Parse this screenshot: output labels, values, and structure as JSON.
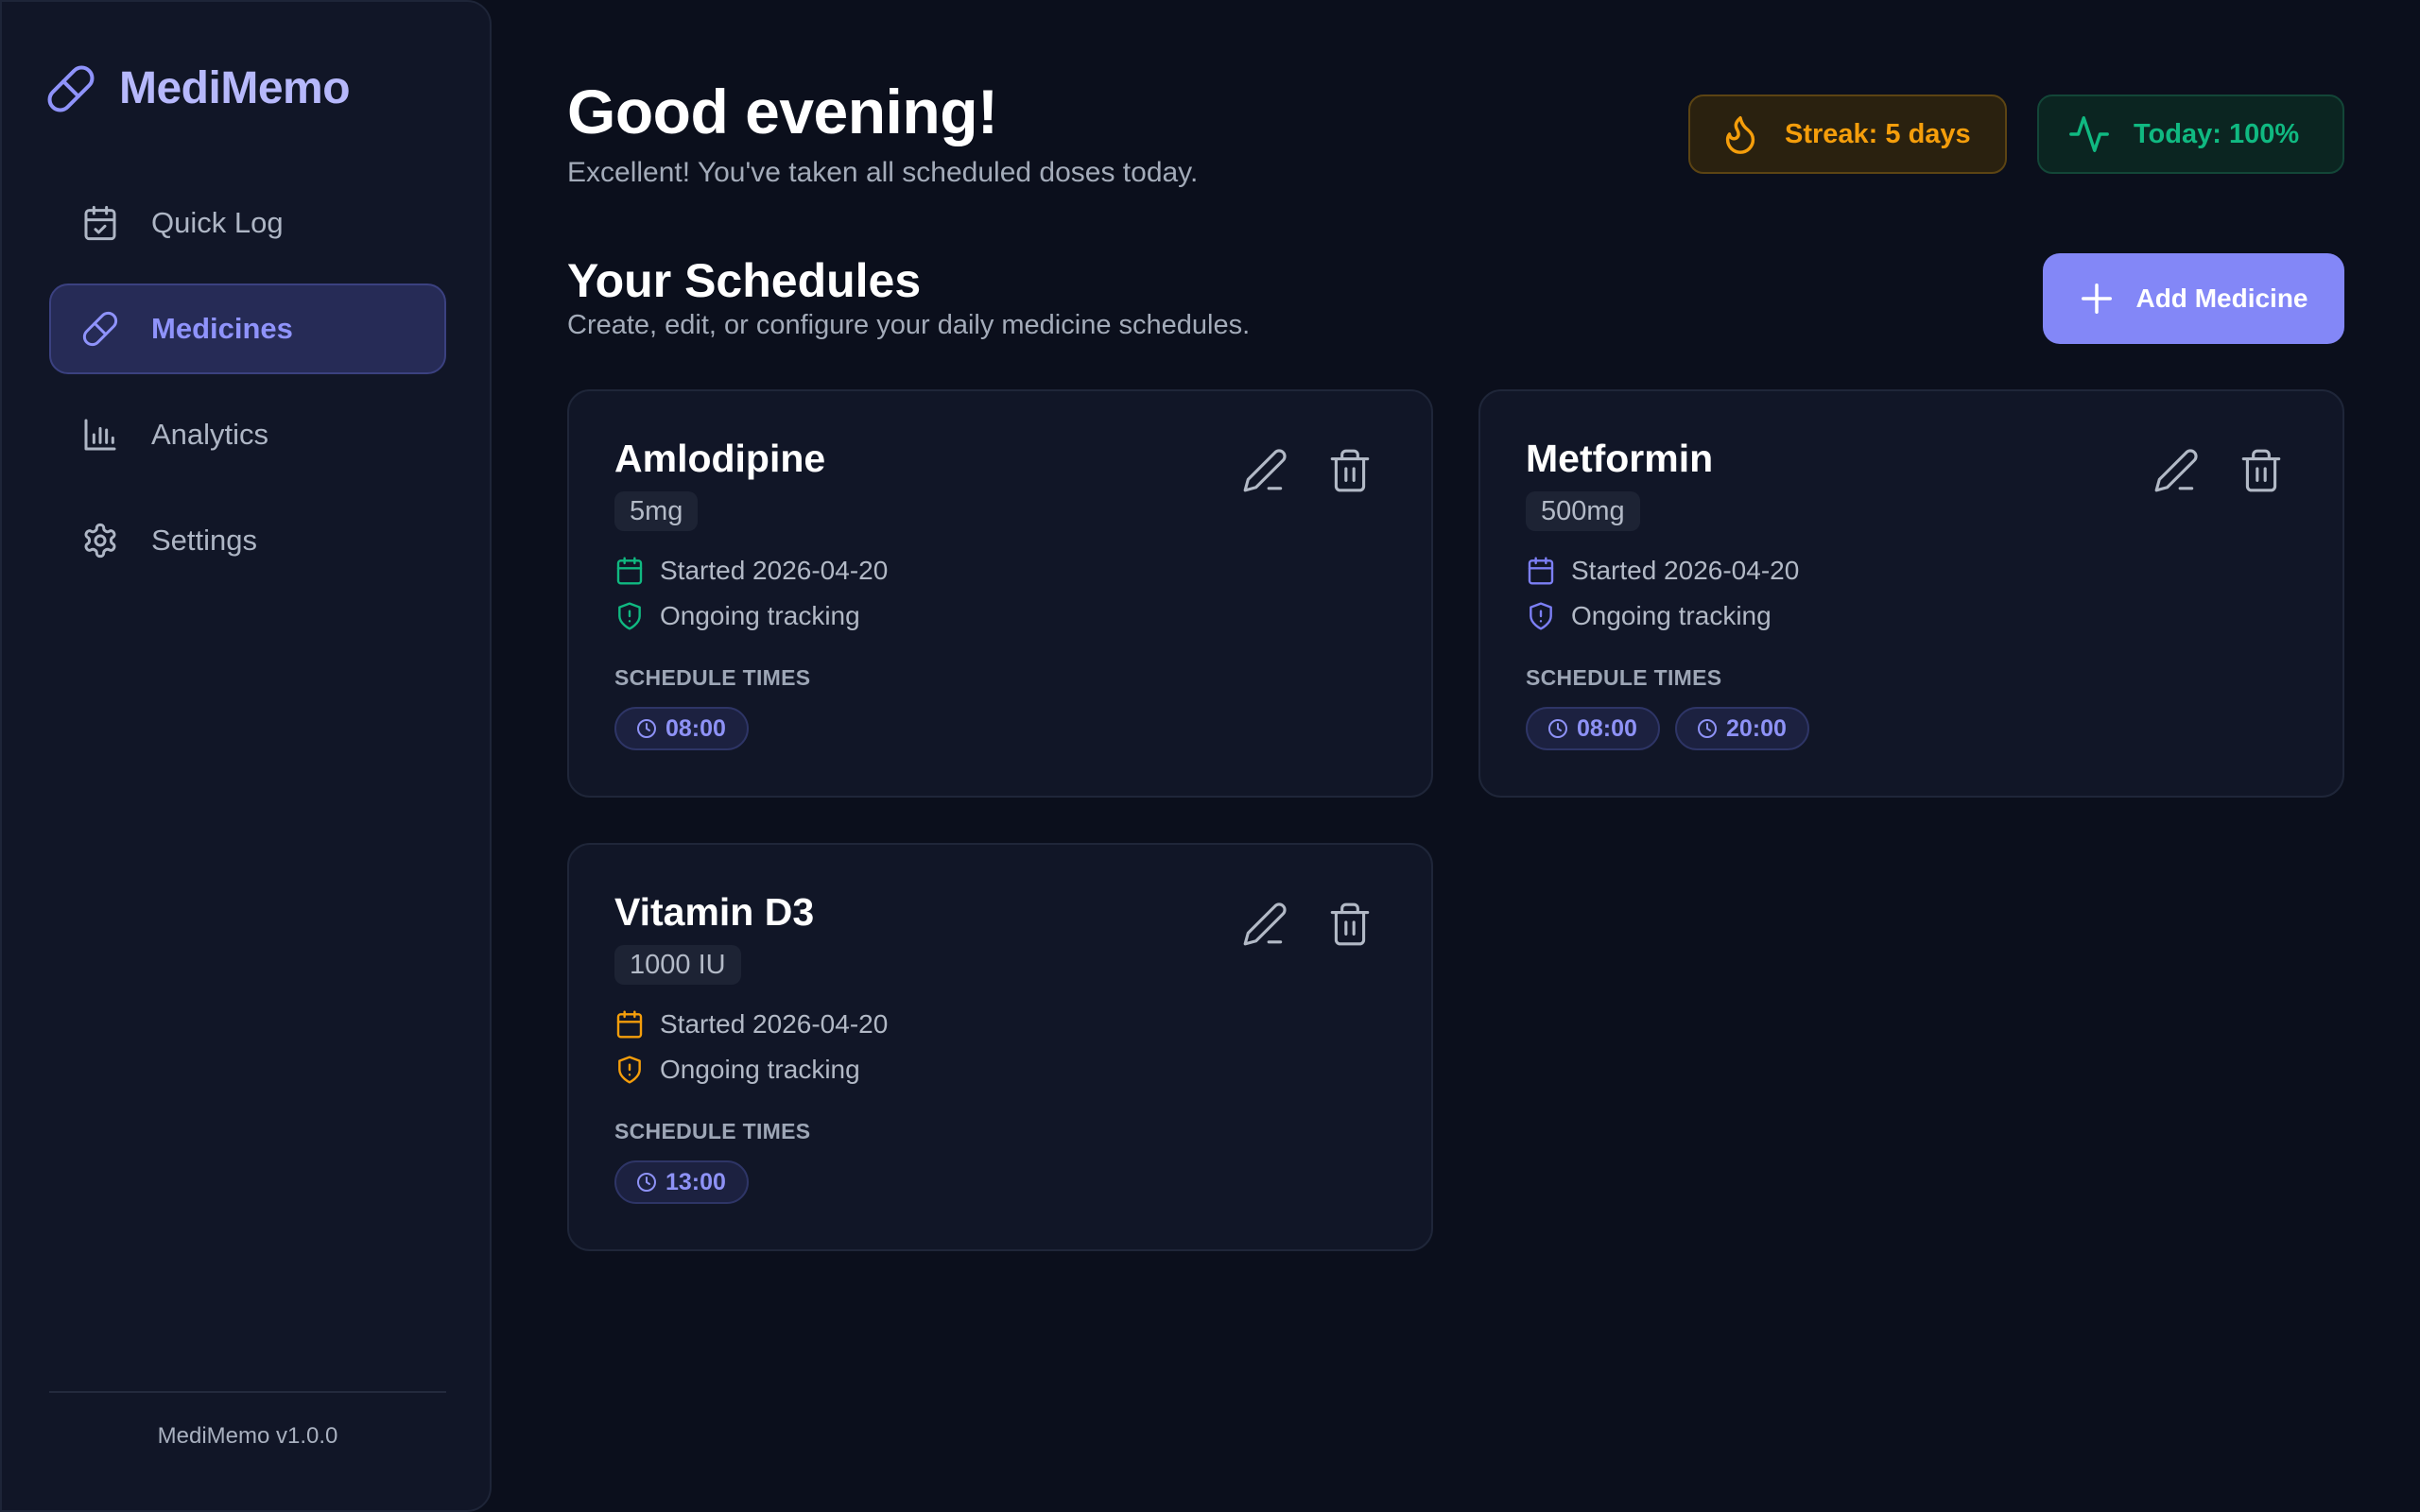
{
  "app": {
    "name": "MediMemo",
    "version": "MediMemo v1.0.0"
  },
  "sidebar": {
    "items": [
      {
        "label": "Quick Log",
        "icon": "calendar-check-icon",
        "active": false
      },
      {
        "label": "Medicines",
        "icon": "pill-icon",
        "active": true
      },
      {
        "label": "Analytics",
        "icon": "bar-chart-icon",
        "active": false
      },
      {
        "label": "Settings",
        "icon": "gear-icon",
        "active": false
      }
    ]
  },
  "header": {
    "greeting": "Good evening!",
    "subtitle": "Excellent! You've taken all scheduled doses today.",
    "streak": "Streak: 5 days",
    "today": "Today: 100%"
  },
  "schedules": {
    "title": "Your Schedules",
    "subtitle": "Create, edit, or configure your daily medicine schedules.",
    "add_label": "Add Medicine",
    "schedule_times_label": "SCHEDULE TIMES",
    "cards": [
      {
        "name": "Amlodipine",
        "dose": "5mg",
        "started": "Started 2026-04-20",
        "tracking": "Ongoing tracking",
        "accent": "#10b981",
        "times": [
          "08:00"
        ]
      },
      {
        "name": "Metformin",
        "dose": "500mg",
        "started": "Started 2026-04-20",
        "tracking": "Ongoing tracking",
        "accent": "#7c7ff5",
        "times": [
          "08:00",
          "20:00"
        ]
      },
      {
        "name": "Vitamin D3",
        "dose": "1000 IU",
        "started": "Started 2026-04-20",
        "tracking": "Ongoing tracking",
        "accent": "#f59e0b",
        "times": [
          "13:00"
        ]
      }
    ]
  },
  "colors": {
    "accent": "#8387f7",
    "streak": "#f59e0b",
    "today": "#10b981",
    "background": "#0b0f1c"
  }
}
